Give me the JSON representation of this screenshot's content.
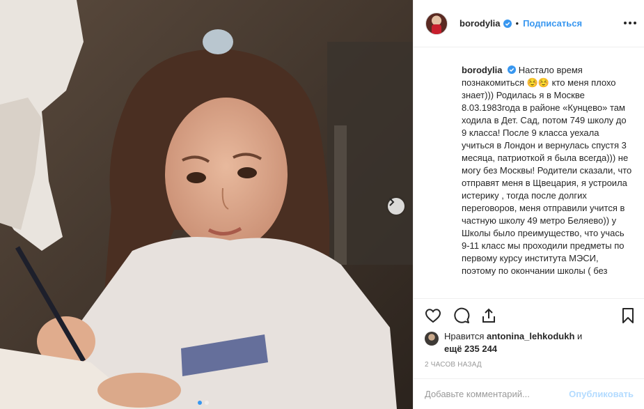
{
  "post": {
    "username": "borodylia",
    "separator": "•",
    "follow_label": "Подписаться",
    "caption_text": "Настало время познакомиться ☺️☺️ кто меня плохо знает))) Родилась я в Москве 8.03.1983года в районе «Кунцево» там ходила в Дет. Сад, потом 749 школу до 9 класса! После 9 класса уехала учиться в Лондон и вернулась спустя 3 месяца, патриоткой я была всегда))) не могу без Москвы! Родители сказали, что отправят меня в Щвецария, я устроила истерику , тогда после долгих переговоров, меня отправили учится в частную школу 49 метро Беляево)) у Школы было преимущество, что учась 9-11 класс мы проходили предметы по первому курсу института МЭСИ, поэтому по окончании школы ( без",
    "likes_prefix": "Нравится",
    "likes_user": "antonina_lehkodukh",
    "likes_and": "и",
    "likes_more": "ещё 235 244",
    "timestamp": "2 часов назад",
    "comment_placeholder": "Добавьте комментарий...",
    "publish_label": "Опубликовать"
  },
  "carousel": {
    "current_slide": 1,
    "total_slides": 2
  },
  "icons": {
    "verified": "verified-badge-icon",
    "more": "more-options-icon",
    "like": "heart-icon",
    "comment": "comment-icon",
    "share": "share-icon",
    "save": "bookmark-icon",
    "next": "chevron-right-icon"
  },
  "colors": {
    "accent": "#3897f0",
    "verified": "#3897f0",
    "muted": "#999999",
    "publish_disabled": "#b3dbff",
    "text": "#262626",
    "border": "#efefef"
  }
}
